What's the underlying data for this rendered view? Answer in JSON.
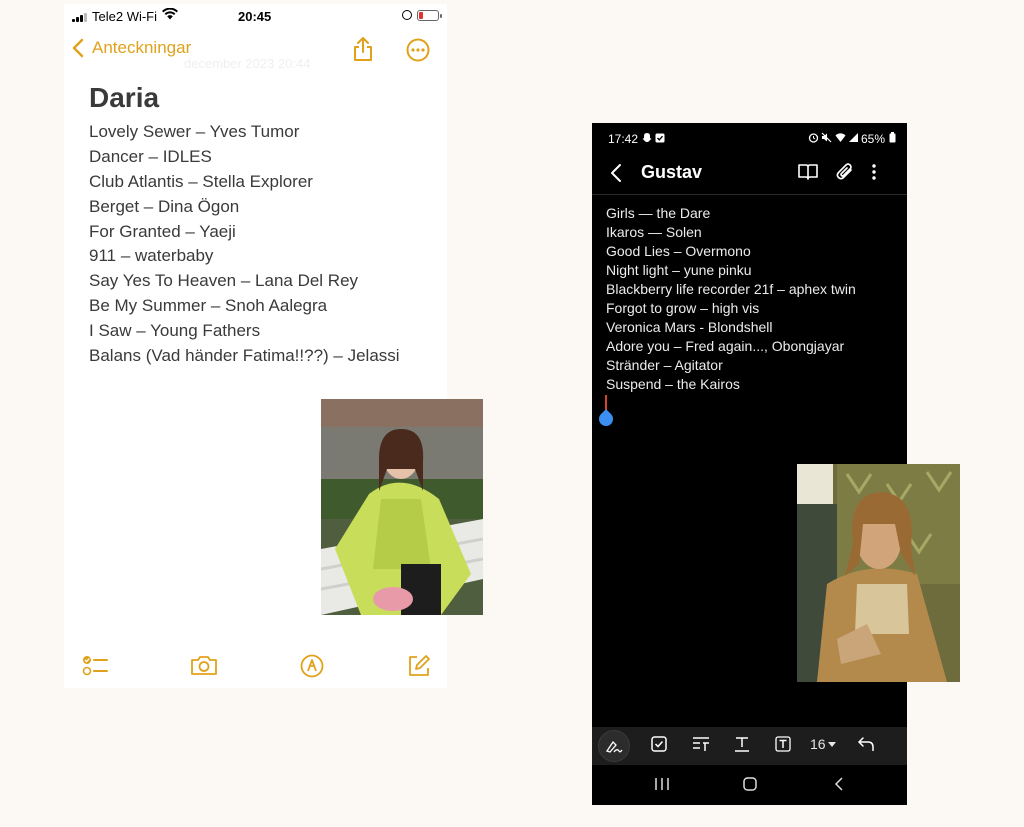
{
  "ios": {
    "status": {
      "carrier": "Tele2 Wi-Fi",
      "time": "20:45"
    },
    "nav": {
      "back_label": "Anteckningar",
      "date_faint": "december 2023 20:44"
    },
    "note": {
      "title": "Daria",
      "items": [
        "Lovely Sewer – Yves Tumor",
        "Dancer – IDLES",
        "Club Atlantis – Stella Explorer",
        "Berget – Dina Ögon",
        "For Granted – Yaeji",
        "911 – waterbaby",
        "Say Yes To Heaven – Lana Del Rey",
        "Be My Summer – Snoh Aalegra",
        "I Saw – Young Fathers",
        "Balans (Vad händer Fatima!!??) – Jelassi"
      ]
    },
    "icons": {
      "back": "chevron-left-icon",
      "share": "share-icon",
      "more": "more-circle-icon",
      "checklist": "checklist-icon",
      "camera": "camera-icon",
      "markup": "markup-pen-icon",
      "compose": "compose-icon"
    },
    "accent_color": "#e0a21b"
  },
  "android": {
    "status": {
      "time": "17:42",
      "battery": "65%"
    },
    "nav": {
      "title": "Gustav"
    },
    "note": {
      "items": [
        "Girls — the Dare",
        "Ikaros — Solen",
        "Good Lies – Overmono",
        "Night light – yune pinku",
        "Blackberry life recorder 21f – aphex twin",
        "Forgot to grow – high vis",
        "Veronica Mars - Blondshell",
        "Adore you – Fred again..., Obongjayar",
        "Stränder – Agitator",
        "Suspend – the Kairos"
      ]
    },
    "toolbar": {
      "font_size": "16"
    },
    "cursor_color": "#3a8ff0"
  }
}
